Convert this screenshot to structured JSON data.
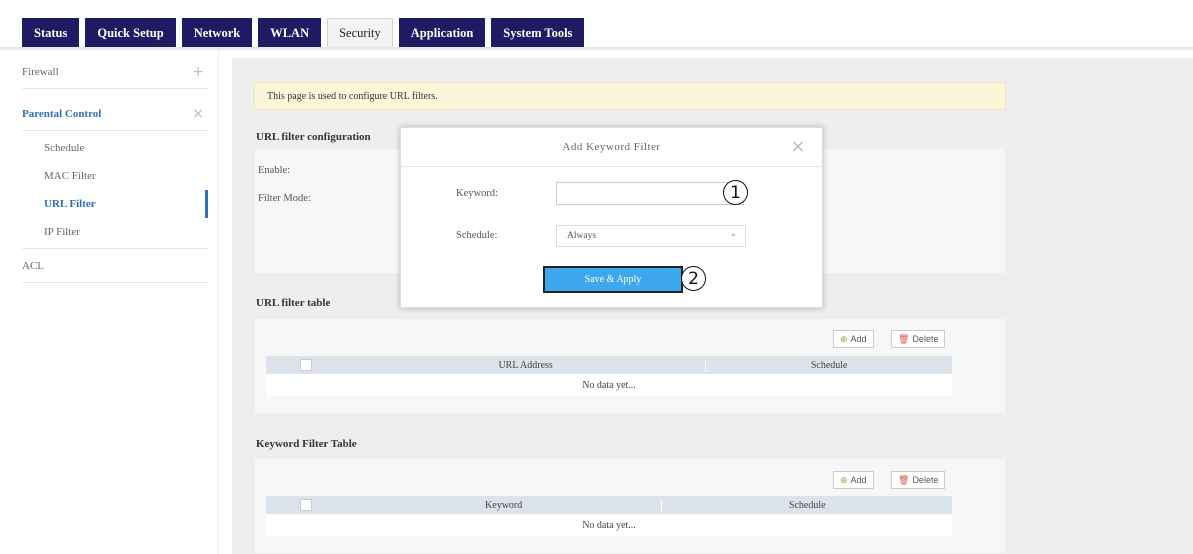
{
  "tabs": [
    {
      "label": "Status"
    },
    {
      "label": "Quick Setup"
    },
    {
      "label": "Network"
    },
    {
      "label": "WLAN"
    },
    {
      "label": "Security"
    },
    {
      "label": "Application"
    },
    {
      "label": "System Tools"
    }
  ],
  "sidebar": {
    "firewall": "Firewall",
    "parental_control": "Parental Control",
    "items": [
      {
        "label": "Schedule"
      },
      {
        "label": "MAC Filter"
      },
      {
        "label": "URL Filter"
      },
      {
        "label": "IP Filter"
      }
    ],
    "acl": "ACL",
    "expand_symbol": "+",
    "collapse_symbol": "×"
  },
  "notice": "This page is used to configure URL filters.",
  "config": {
    "title": "URL filter configuration",
    "enable_label": "Enable:",
    "filter_mode_label": "Filter Mode:"
  },
  "url_table": {
    "title": "URL filter table",
    "add_label": "Add",
    "delete_label": "Delete",
    "columns": [
      "URL Address",
      "Schedule"
    ],
    "empty": "No data yet..."
  },
  "keyword_table": {
    "title": "Keyword Filter Table",
    "add_label": "Add",
    "delete_label": "Delete",
    "columns": [
      "Keyword",
      "Schedule"
    ],
    "empty": "No data yet..."
  },
  "dialog": {
    "title": "Add Keyword Filter",
    "close": "×",
    "keyword_label": "Keyword:",
    "keyword_value": "",
    "schedule_label": "Schedule:",
    "schedule_value": "Always",
    "save_label": "Save & Apply",
    "marker1": "1",
    "marker2": "2"
  },
  "colors": {
    "tab_bg": "#1f1a63",
    "accent_blue": "#2f6fb6",
    "save_btn": "#3ea8ec",
    "notice_bg": "#fbf6d9"
  }
}
